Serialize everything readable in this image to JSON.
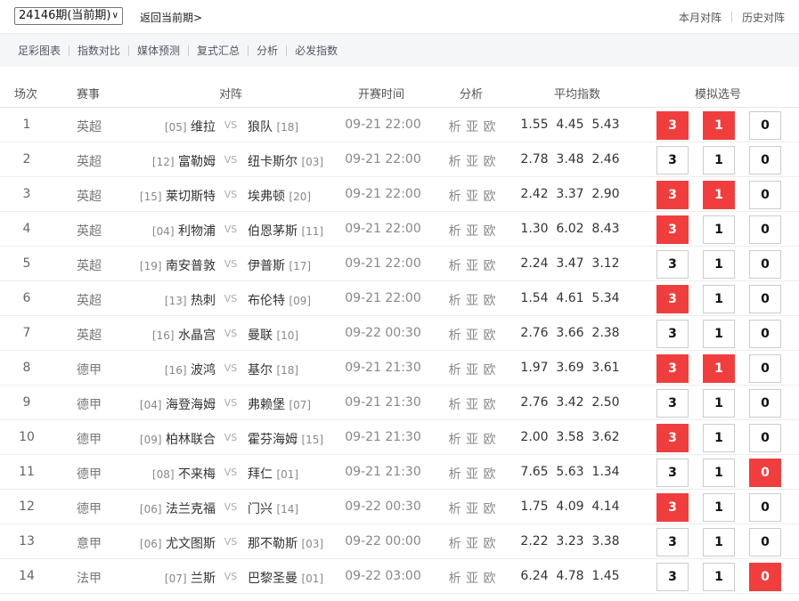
{
  "topbar": {
    "period_select": "24146期(当前期)",
    "back_link": "返回当前期>",
    "monthly": "本月对阵",
    "history": "历史对阵"
  },
  "subnav": [
    "足彩图表",
    "指数对比",
    "媒体预测",
    "复式汇总",
    "分析",
    "必发指数"
  ],
  "table_header": {
    "idx": "场次",
    "league": "赛事",
    "match": "对阵",
    "time": "开赛时间",
    "analysis": "分析",
    "odds": "平均指数",
    "pick": "模拟选号"
  },
  "analysis_links": [
    "析",
    "亚",
    "欧"
  ],
  "pick_labels": [
    "3",
    "1",
    "0"
  ],
  "vs": "VS",
  "colors": {
    "accent": "#f03e3e"
  },
  "rows": [
    {
      "idx": "1",
      "league": "英超",
      "home": "维拉",
      "home_rank": "[05]",
      "away": "狼队",
      "away_rank": "[18]",
      "time": "09-21 22:00",
      "odds": [
        "1.55",
        "4.45",
        "5.43"
      ],
      "picks": [
        true,
        true,
        false
      ]
    },
    {
      "idx": "2",
      "league": "英超",
      "home": "富勒姆",
      "home_rank": "[12]",
      "away": "纽卡斯尔",
      "away_rank": "[03]",
      "time": "09-21 22:00",
      "odds": [
        "2.78",
        "3.48",
        "2.46"
      ],
      "picks": [
        false,
        false,
        false
      ]
    },
    {
      "idx": "3",
      "league": "英超",
      "home": "莱切斯特",
      "home_rank": "[15]",
      "away": "埃弗顿",
      "away_rank": "[20]",
      "time": "09-21 22:00",
      "odds": [
        "2.42",
        "3.37",
        "2.90"
      ],
      "picks": [
        true,
        true,
        false
      ]
    },
    {
      "idx": "4",
      "league": "英超",
      "home": "利物浦",
      "home_rank": "[04]",
      "away": "伯恩茅斯",
      "away_rank": "[11]",
      "time": "09-21 22:00",
      "odds": [
        "1.30",
        "6.02",
        "8.43"
      ],
      "picks": [
        true,
        false,
        false
      ]
    },
    {
      "idx": "5",
      "league": "英超",
      "home": "南安普敦",
      "home_rank": "[19]",
      "away": "伊普斯",
      "away_rank": "[17]",
      "time": "09-21 22:00",
      "odds": [
        "2.24",
        "3.47",
        "3.12"
      ],
      "picks": [
        false,
        false,
        false
      ]
    },
    {
      "idx": "6",
      "league": "英超",
      "home": "热刺",
      "home_rank": "[13]",
      "away": "布伦特",
      "away_rank": "[09]",
      "time": "09-21 22:00",
      "odds": [
        "1.54",
        "4.61",
        "5.34"
      ],
      "picks": [
        true,
        false,
        false
      ]
    },
    {
      "idx": "7",
      "league": "英超",
      "home": "水晶宫",
      "home_rank": "[16]",
      "away": "曼联",
      "away_rank": "[10]",
      "time": "09-22 00:30",
      "odds": [
        "2.76",
        "3.66",
        "2.38"
      ],
      "picks": [
        false,
        false,
        false
      ]
    },
    {
      "idx": "8",
      "league": "德甲",
      "home": "波鸿",
      "home_rank": "[16]",
      "away": "基尔",
      "away_rank": "[18]",
      "time": "09-21 21:30",
      "odds": [
        "1.97",
        "3.69",
        "3.61"
      ],
      "picks": [
        true,
        true,
        false
      ]
    },
    {
      "idx": "9",
      "league": "德甲",
      "home": "海登海姆",
      "home_rank": "[04]",
      "away": "弗赖堡",
      "away_rank": "[07]",
      "time": "09-21 21:30",
      "odds": [
        "2.76",
        "3.42",
        "2.50"
      ],
      "picks": [
        false,
        false,
        false
      ]
    },
    {
      "idx": "10",
      "league": "德甲",
      "home": "柏林联合",
      "home_rank": "[09]",
      "away": "霍芬海姆",
      "away_rank": "[15]",
      "time": "09-21 21:30",
      "odds": [
        "2.00",
        "3.58",
        "3.62"
      ],
      "picks": [
        true,
        false,
        false
      ]
    },
    {
      "idx": "11",
      "league": "德甲",
      "home": "不来梅",
      "home_rank": "[08]",
      "away": "拜仁",
      "away_rank": "[01]",
      "time": "09-21 21:30",
      "odds": [
        "7.65",
        "5.63",
        "1.34"
      ],
      "picks": [
        false,
        false,
        true
      ]
    },
    {
      "idx": "12",
      "league": "德甲",
      "home": "法兰克福",
      "home_rank": "[06]",
      "away": "门兴",
      "away_rank": "[14]",
      "time": "09-22 00:30",
      "odds": [
        "1.75",
        "4.09",
        "4.14"
      ],
      "picks": [
        true,
        false,
        false
      ]
    },
    {
      "idx": "13",
      "league": "意甲",
      "home": "尤文图斯",
      "home_rank": "[06]",
      "away": "那不勒斯",
      "away_rank": "[03]",
      "time": "09-22 00:00",
      "odds": [
        "2.22",
        "3.23",
        "3.38"
      ],
      "picks": [
        false,
        false,
        false
      ]
    },
    {
      "idx": "14",
      "league": "法甲",
      "home": "兰斯",
      "home_rank": "[07]",
      "away": "巴黎圣曼",
      "away_rank": "[01]",
      "time": "09-22 03:00",
      "odds": [
        "6.24",
        "4.78",
        "1.45"
      ],
      "picks": [
        false,
        false,
        true
      ]
    }
  ]
}
